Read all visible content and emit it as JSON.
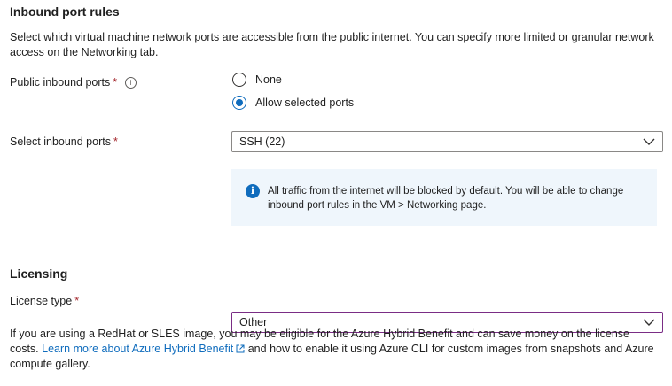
{
  "inbound": {
    "title": "Inbound port rules",
    "description": "Select which virtual machine network ports are accessible from the public internet. You can specify more limited or granular network access on the Networking tab.",
    "public_ports": {
      "label": "Public inbound ports",
      "required": "*",
      "options": [
        {
          "label": "None",
          "selected": false
        },
        {
          "label": "Allow selected ports",
          "selected": true
        }
      ]
    },
    "select_ports": {
      "label": "Select inbound ports",
      "required": "*",
      "value": "SSH (22)"
    },
    "info_text": "All traffic from the internet will be blocked by default. You will be able to change inbound port rules in the VM > Networking page."
  },
  "licensing": {
    "title": "Licensing",
    "license_type": {
      "label": "License type",
      "required": "*",
      "value": "Other"
    },
    "description_before": "If you are using a RedHat or SLES image, you may be eligible for the Azure Hybrid Benefit and can save money on the license costs.",
    "link_text": "Learn more about Azure Hybrid Benefit",
    "description_after": "and how to enable it using Azure CLI for custom images from snapshots and Azure compute gallery."
  },
  "colors": {
    "accent": "#0f6cbd",
    "required": "#a4262c",
    "focus_border": "#7a2d85",
    "info_bg": "#eff6fc"
  }
}
